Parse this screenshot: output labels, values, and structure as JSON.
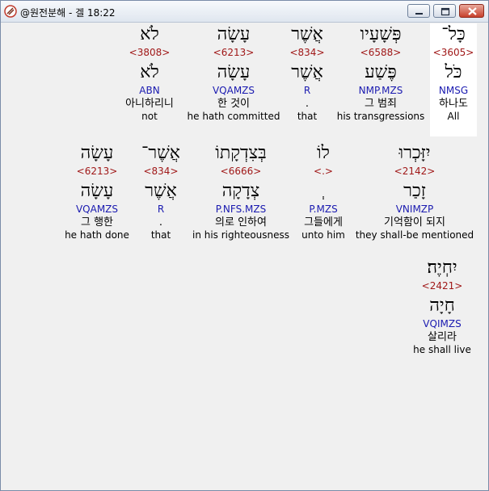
{
  "window": {
    "title": "@원전분해 - 겔 18:22",
    "icon": "app-logo-icon",
    "buttons": {
      "minimize": "minimize-icon",
      "maximize": "maximize-icon",
      "close": "close-icon"
    }
  },
  "rows": [
    {
      "words": [
        {
          "hebrew": "כָּל־",
          "strong": "<3605>",
          "root": "כֹּל",
          "morph": "NMSG",
          "korean": "하나도",
          "english": "All",
          "highlighted": true
        },
        {
          "hebrew": "פְּשָׁעָיו",
          "strong": "<6588>",
          "root": "פֶּשַׁע",
          "morph": "NMP.MZS",
          "korean": "그 범죄",
          "english": "his transgressions"
        },
        {
          "hebrew": "אֲשֶׁר",
          "strong": "<834>",
          "root": "אֲשֶׁר",
          "morph": "R",
          "korean": ".",
          "english": "that"
        },
        {
          "hebrew": "עָשָׂה",
          "strong": "<6213>",
          "root": "עָשָׂה",
          "morph": "VQAMZS",
          "korean": "한 것이",
          "english": "he hath committed"
        },
        {
          "hebrew": "לֹא",
          "strong": "<3808>",
          "root": "לֹא",
          "morph": "ABN",
          "korean": "아니하리니",
          "english": "not"
        }
      ]
    },
    {
      "words": [
        {
          "hebrew": "יִזָּכְרוּ",
          "strong": "<2142>",
          "root": "זָכַר",
          "morph": "VNIMZP",
          "korean": "기억함이 되지",
          "english": "they shall-be mentioned"
        },
        {
          "hebrew": "לוֹ",
          "strong": "<.>",
          "root": "ְ",
          "morph": "P.MZS",
          "korean": "그들에게",
          "english": "unto him"
        },
        {
          "hebrew": "בְּצִדְקָתוֹ",
          "strong": "<6666>",
          "root": "צְדָקָה",
          "morph": "P.NFS.MZS",
          "korean": "의로 인하여",
          "english": "in his righteousness"
        },
        {
          "hebrew": "אֲשֶׁר־",
          "strong": "<834>",
          "root": "אֲשֶׁר",
          "morph": "R",
          "korean": ".",
          "english": "that"
        },
        {
          "hebrew": "עָשָׂה",
          "strong": "<6213>",
          "root": "עָשָׂה",
          "morph": "VQAMZS",
          "korean": "그 행한",
          "english": "he hath done"
        }
      ]
    },
    {
      "words": [
        {
          "hebrew": "יִחְיֶה׃",
          "strong": "<2421>",
          "root": "חָיָה",
          "morph": "VQIMZS",
          "korean": "살리라",
          "english": "he shall live"
        }
      ]
    }
  ]
}
